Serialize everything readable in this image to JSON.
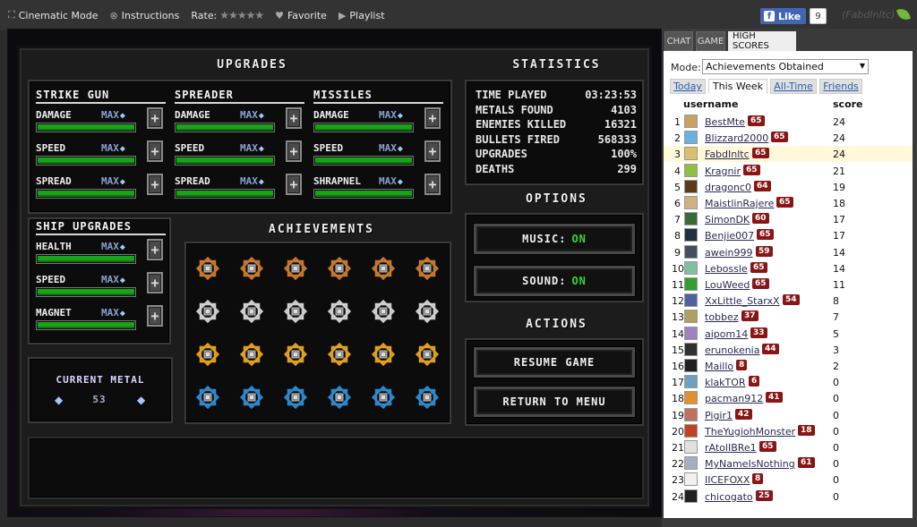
{
  "topbar": {
    "cinematic": "Cinematic Mode",
    "instructions": "Instructions",
    "rate": "Rate:",
    "stars": "★★★★★",
    "favorite": "Favorite",
    "playlist": "Playlist",
    "fb_like": "Like",
    "fb_count": "9",
    "user": "(FabdInltc)"
  },
  "game": {
    "upgrades_title": "UPGRADES",
    "statistics_title": "STATISTICS",
    "options_title": "OPTIONS",
    "actions_title": "ACTIONS",
    "achievements_title": "ACHIEVEMENTS",
    "max_label": "MAX",
    "weapons": [
      {
        "name": "STRIKE GUN",
        "stats": [
          {
            "label": "DAMAGE",
            "level": 1.0
          },
          {
            "label": "SPEED",
            "level": 1.0
          },
          {
            "label": "SPREAD",
            "level": 1.0
          }
        ]
      },
      {
        "name": "SPREADER",
        "stats": [
          {
            "label": "DAMAGE",
            "level": 1.0
          },
          {
            "label": "SPEED",
            "level": 1.0
          },
          {
            "label": "SPREAD",
            "level": 1.0
          }
        ]
      },
      {
        "name": "MISSILES",
        "stats": [
          {
            "label": "DAMAGE",
            "level": 1.0
          },
          {
            "label": "SPEED",
            "level": 1.0
          },
          {
            "label": "SHRAPNEL",
            "level": 1.0
          }
        ]
      }
    ],
    "ship": {
      "name": "SHIP UPGRADES",
      "stats": [
        {
          "label": "HEALTH",
          "level": 1.0
        },
        {
          "label": "SPEED",
          "level": 1.0
        },
        {
          "label": "MAGNET",
          "level": 1.0
        }
      ]
    },
    "current_metal_label": "CURRENT METAL",
    "current_metal_value": "53",
    "stats": [
      {
        "label": "TIME PLAYED",
        "value": "03:23:53"
      },
      {
        "label": "METALS FOUND",
        "value": "4103"
      },
      {
        "label": "ENEMIES KILLED",
        "value": "16321"
      },
      {
        "label": "BULLETS FIRED",
        "value": "568333"
      },
      {
        "label": "UPGRADES",
        "value": "100%"
      },
      {
        "label": "DEATHS",
        "value": "299"
      }
    ],
    "music_label": "MUSIC:",
    "music_value": "ON",
    "sound_label": "SOUND:",
    "sound_value": "ON",
    "resume": "RESUME GAME",
    "return": "RETURN TO MENU",
    "achievement_rows": [
      "#c8782a",
      "#cfcfcf",
      "#e0a020",
      "#2a8ad0"
    ],
    "colors": {
      "bar": "#1aa21a",
      "on": "#35d735"
    }
  },
  "side": {
    "tabs": [
      "CHAT",
      "GAME",
      "HIGH SCORES"
    ],
    "mode_label": "Mode:",
    "mode_value": "Achievements Obtained",
    "time_tabs": [
      "Today",
      "This Week",
      "All-Time",
      "Friends"
    ],
    "col_user": "username",
    "col_score": "score",
    "rows": [
      {
        "rank": "1",
        "user": "BestMte",
        "level": "65",
        "score": "24",
        "color": "#c9a060"
      },
      {
        "rank": "2",
        "user": "Blizzard2000",
        "level": "65",
        "score": "24",
        "color": "#6ab0e0"
      },
      {
        "rank": "3",
        "user": "FabdInltc",
        "level": "65",
        "score": "24",
        "color": "#d8c070"
      },
      {
        "rank": "4",
        "user": "Kragnir",
        "level": "65",
        "score": "21",
        "color": "#90c040"
      },
      {
        "rank": "5",
        "user": "dragonc0",
        "level": "64",
        "score": "19",
        "color": "#5a3a1a"
      },
      {
        "rank": "6",
        "user": "MaistlinRajere",
        "level": "65",
        "score": "18",
        "color": "#d0b080"
      },
      {
        "rank": "7",
        "user": "SimonDK",
        "level": "60",
        "score": "17",
        "color": "#3a6a3a"
      },
      {
        "rank": "8",
        "user": "Benjie007",
        "level": "65",
        "score": "17",
        "color": "#203040"
      },
      {
        "rank": "9",
        "user": "awein999",
        "level": "59",
        "score": "14",
        "color": "#405060"
      },
      {
        "rank": "10",
        "user": "Lebossle",
        "level": "65",
        "score": "14",
        "color": "#80c0a0"
      },
      {
        "rank": "11",
        "user": "LouWeed",
        "level": "65",
        "score": "11",
        "color": "#30a030"
      },
      {
        "rank": "12",
        "user": "XxLittle_StarxX",
        "level": "54",
        "score": "8",
        "color": "#5060a0"
      },
      {
        "rank": "13",
        "user": "tobbez",
        "level": "37",
        "score": "7",
        "color": "#b0a060"
      },
      {
        "rank": "14",
        "user": "aipom14",
        "level": "33",
        "score": "5",
        "color": "#a080c0"
      },
      {
        "rank": "15",
        "user": "erunokenia",
        "level": "44",
        "score": "3",
        "color": "#303030"
      },
      {
        "rank": "16",
        "user": "Maillo",
        "level": "8",
        "score": "2",
        "color": "#202020"
      },
      {
        "rank": "17",
        "user": "klakTOR",
        "level": "6",
        "score": "0",
        "color": "#70a0c0"
      },
      {
        "rank": "18",
        "user": "pacman912",
        "level": "41",
        "score": "0",
        "color": "#e09030"
      },
      {
        "rank": "19",
        "user": "Pigir1",
        "level": "42",
        "score": "0",
        "color": "#c07060"
      },
      {
        "rank": "20",
        "user": "TheYugiohMonster",
        "level": "18",
        "score": "0",
        "color": "#c04020"
      },
      {
        "rank": "21",
        "user": "rAtolIBRe1",
        "level": "65",
        "score": "0",
        "color": "#e0e0e0"
      },
      {
        "rank": "22",
        "user": "MyNameIsNothing",
        "level": "61",
        "score": "0",
        "color": "#a0b0c0"
      },
      {
        "rank": "23",
        "user": "IICEFOXX",
        "level": "8",
        "score": "0",
        "color": "#f0f0f0"
      },
      {
        "rank": "24",
        "user": "chicogato",
        "level": "25",
        "score": "0",
        "color": "#202020"
      }
    ]
  }
}
